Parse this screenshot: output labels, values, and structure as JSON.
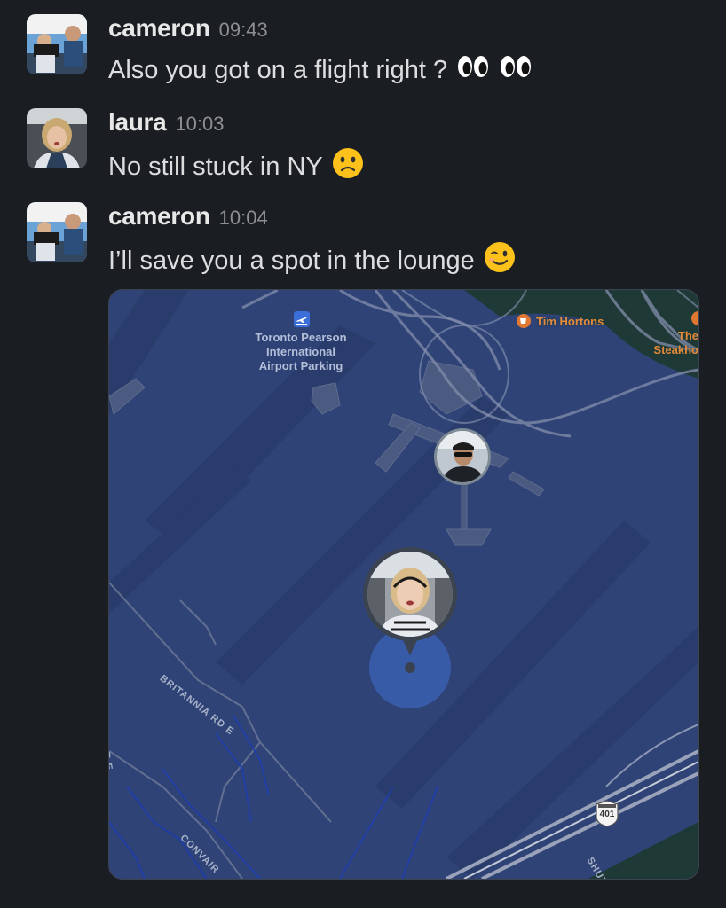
{
  "messages": [
    {
      "author": "cameron",
      "time": "09:43",
      "text": "Also you got on a flight right ?",
      "emoji": [
        "eyes-emoji",
        "eyes-emoji"
      ]
    },
    {
      "author": "laura",
      "time": "10:03",
      "text": "No still stuck in NY",
      "emoji": [
        "slightly-frowning-face-emoji"
      ]
    },
    {
      "author": "cameron",
      "time": "10:04",
      "text": "I’ll save you a spot in the lounge",
      "emoji": [
        "winking-face-emoji"
      ]
    }
  ],
  "map": {
    "places": {
      "airport": "Toronto Pearson\nInternational\nAirport Parking",
      "tim_hortons": "Tim Hortons",
      "steakhouse": "The\nSteakho"
    },
    "roads": {
      "britannia": "BRITANNIA RD E",
      "convair": "CONVAIR",
      "shut": "SHUT",
      "re": "R E"
    },
    "highway_shield": "401",
    "colors": {
      "land": "#2f4377",
      "water": "#1f3a36",
      "accent": "#3b6ed8"
    }
  }
}
